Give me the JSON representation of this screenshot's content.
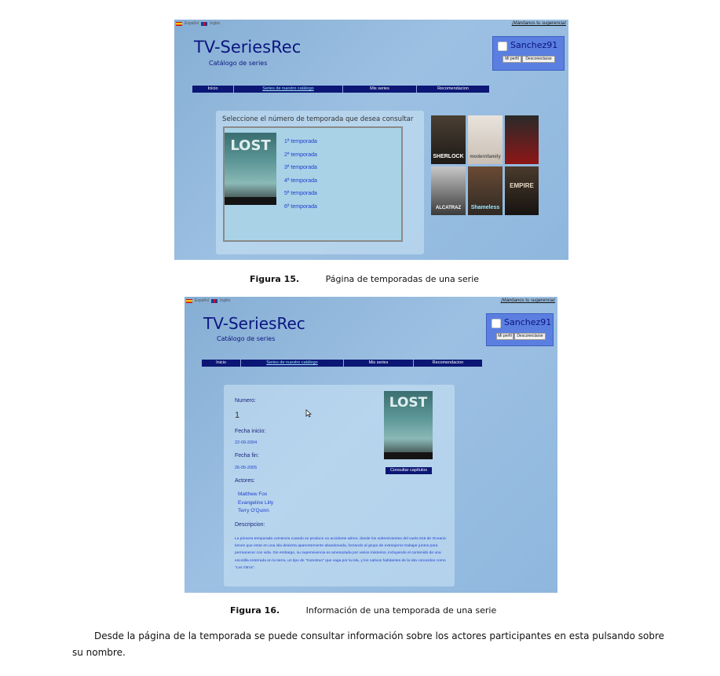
{
  "site": {
    "lang_es": "Español",
    "lang_en": "Inglés",
    "suggest": "¡Mándanos tu sugerencia!",
    "title": "TV-SeriesRec",
    "subtitle": "Catálogo de series",
    "username": "Sanchez91",
    "profile_btn": "Mi perfil",
    "logout_btn": "Desconectarse",
    "nav": [
      "Inicio",
      "Series de nuestro catálogo",
      "Mis series",
      "Recomendacion"
    ]
  },
  "fig15": {
    "panel_title": "Seleccione el número de temporada que desea consultar",
    "poster_text": "LOST",
    "seasons": [
      "1ª temporada",
      "2ª temporada",
      "3ª temporada",
      "4ª temporada",
      "5ª temporada",
      "6ª temporada"
    ],
    "thumbs": [
      "SHERLOCK",
      "modernfamily",
      "",
      "ALCATRAZ",
      "Shameless",
      "EMPIRE"
    ],
    "caption_label": "Figura 15.",
    "caption_text": "Página de temporadas de una serie"
  },
  "fig16": {
    "numero_label": "Numero:",
    "numero_value": "1",
    "inicio_label": "Fecha inicio:",
    "inicio_value": "22-09-2004",
    "fin_label": "Fecha fin:",
    "fin_value": "26-05-2005",
    "actores_label": "Actores:",
    "actores": [
      "Matthew Fox",
      "Evangeline Lilly",
      "Terry O'Quinn"
    ],
    "desc_label": "Descripcion:",
    "desc_text": "La primera temporada comienza cuando se produce un accidente aéreo, donde los sobrevivientes del vuelo 815 de Oceanic tienen que estar en una isla desierta aparentemente abandonada, forzando al grupo de extranjeros trabajar juntos para permanecer con vida. Sin embargo, su supervivencia es amenazada por varios misterios, incluyendo el contenido de una escotilla enterrada en la tierra, un tipo de \"monstruo\" que vaga por la isla, y los nativos habitantes de la isla conocidos como \"Los Otros\".",
    "poster_text": "LOST",
    "consult_btn": "Consultar capítulos",
    "caption_label": "Figura 16.",
    "caption_text": "Información de una temporada de una serie"
  },
  "body_text": "Desde la página de la temporada se puede consultar información sobre los actores participantes en esta pulsando sobre su nombre."
}
